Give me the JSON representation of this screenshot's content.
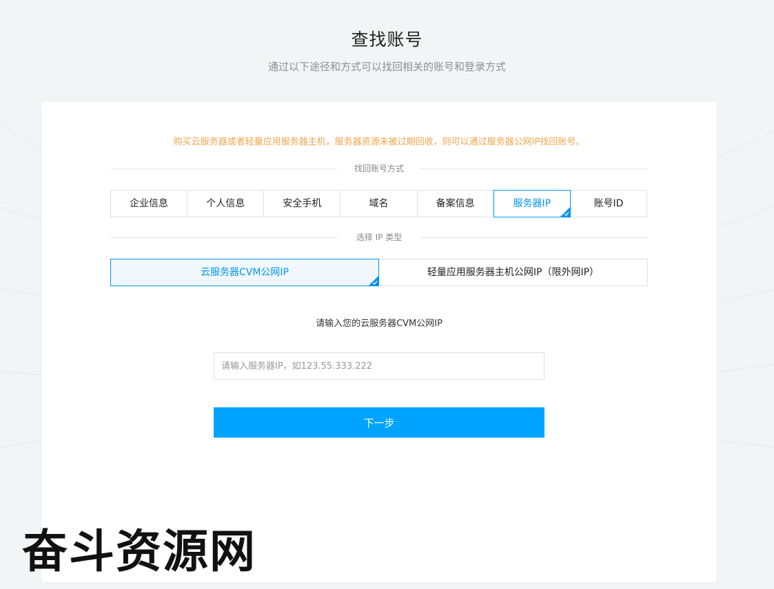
{
  "header": {
    "title": "查找账号",
    "subtitle": "通过以下途径和方式可以找回相关的账号和登录方式"
  },
  "card": {
    "notice": "购买云服务器或者轻量应用服务器主机，服务器资源未被过期回收，则可以通过服务器公网IP找回账号。",
    "method_label": "找回账号方式",
    "tabs": [
      {
        "label": "企业信息",
        "active": false
      },
      {
        "label": "个人信息",
        "active": false
      },
      {
        "label": "安全手机",
        "active": false
      },
      {
        "label": "域名",
        "active": false
      },
      {
        "label": "备案信息",
        "active": false
      },
      {
        "label": "服务器IP",
        "active": true
      },
      {
        "label": "账号ID",
        "active": false
      }
    ],
    "ip_type_label": "选择 IP 类型",
    "ip_types": [
      {
        "label": "云服务器CVM公网IP",
        "active": true
      },
      {
        "label": "轻量应用服务器主机公网IP（限外网IP）",
        "active": false
      }
    ],
    "prompt": "请输入您的云服务器CVM公网IP",
    "input": {
      "value": "",
      "placeholder": "请输入服务器IP，如123.55.333.222"
    },
    "next_label": "下一步"
  },
  "watermark": "奋斗资源网",
  "colors": {
    "accent": "#0095ea",
    "button": "#00a4ff",
    "notice": "#f0a44a",
    "background": "#f3f4f6"
  }
}
